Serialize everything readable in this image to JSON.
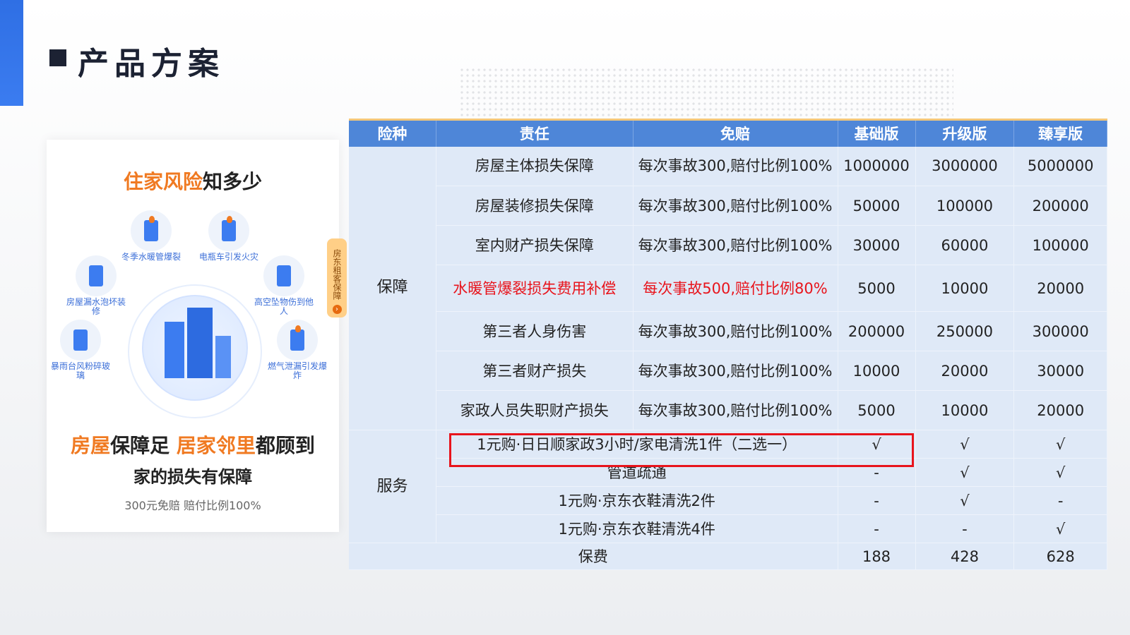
{
  "page": {
    "title": "产品方案"
  },
  "card": {
    "heading_orange": "住家风险",
    "heading_rest": "知多少",
    "risks": [
      {
        "icon": "water-heater-icon",
        "label": "冬季水暖管爆裂"
      },
      {
        "icon": "ebike-fire-icon",
        "label": "电瓶车引发火灾"
      },
      {
        "icon": "water-leak-icon",
        "label": "房屋漏水泡坏装修"
      },
      {
        "icon": "falling-object-icon",
        "label": "高空坠物伤到他人"
      },
      {
        "icon": "storm-icon",
        "label": "暴雨台风粉碎玻璃"
      },
      {
        "icon": "gas-explosion-icon",
        "label": "燃气泄漏引发爆炸"
      }
    ],
    "slogan1_a": "房屋",
    "slogan1_b": "保障足 ",
    "slogan1_c": "居家邻里",
    "slogan1_d": "都顾到",
    "slogan2": "家的损失有保障",
    "note": "300元免赔 赔付比例100%",
    "side_tab": "房东租客保障",
    "side_tab_arrow": "›"
  },
  "table": {
    "headers": [
      "险种",
      "责任",
      "免赔",
      "基础版",
      "升级版",
      "臻享版"
    ],
    "coverage_category": "保障",
    "coverage_rows": [
      {
        "item": "房屋主体损失保障",
        "waiver": "每次事故300,赔付比例100%",
        "basic": "1000000",
        "upgrade": "3000000",
        "premium": "5000000"
      },
      {
        "item": "房屋装修损失保障",
        "waiver": "每次事故300,赔付比例100%",
        "basic": "50000",
        "upgrade": "100000",
        "premium": "200000"
      },
      {
        "item": "室内财产损失保障",
        "waiver": "每次事故300,赔付比例100%",
        "basic": "30000",
        "upgrade": "60000",
        "premium": "100000"
      },
      {
        "item": "水暖管爆裂损失费用补偿",
        "waiver": "每次事故500,赔付比例80%",
        "basic": "5000",
        "upgrade": "10000",
        "premium": "20000"
      },
      {
        "item": "第三者人身伤害",
        "waiver": "每次事故300,赔付比例100%",
        "basic": "200000",
        "upgrade": "250000",
        "premium": "300000"
      },
      {
        "item": "第三者财产损失",
        "waiver": "每次事故300,赔付比例100%",
        "basic": "10000",
        "upgrade": "20000",
        "premium": "30000"
      },
      {
        "item": "家政人员失职财产损失",
        "waiver": "每次事故300,赔付比例100%",
        "basic": "5000",
        "upgrade": "10000",
        "premium": "20000"
      }
    ],
    "service_category": "服务",
    "service_rows": [
      {
        "item": "1元购·日日顺家政3小时/家电清洗1件（二选一）",
        "basic": "√",
        "upgrade": "√",
        "premium": "√"
      },
      {
        "item": "管道疏通",
        "basic": "-",
        "upgrade": "√",
        "premium": "√"
      },
      {
        "item": "1元购·京东衣鞋清洗2件",
        "basic": "-",
        "upgrade": "√",
        "premium": "-"
      },
      {
        "item": "1元购·京东衣鞋清洗4件",
        "basic": "-",
        "upgrade": "-",
        "premium": "√"
      }
    ],
    "fee_label": "保费",
    "fee": {
      "basic": "188",
      "upgrade": "428",
      "premium": "628"
    },
    "highlight_color": "#e8141c"
  }
}
